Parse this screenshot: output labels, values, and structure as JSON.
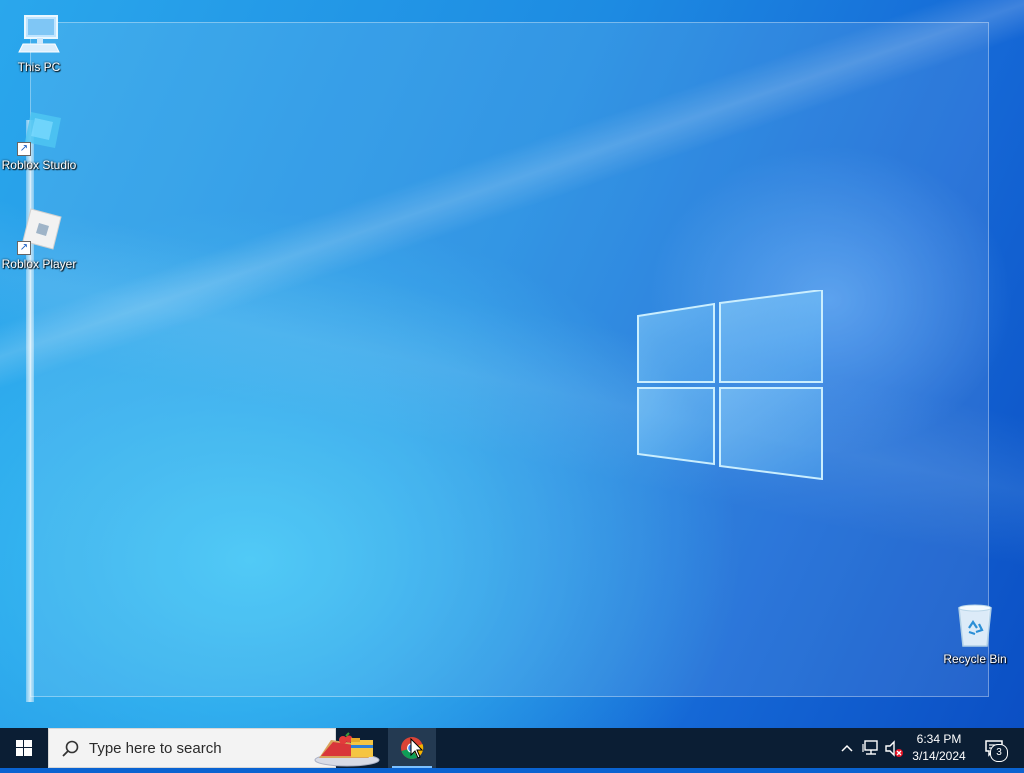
{
  "desktop": {
    "icons": [
      {
        "label": "This PC",
        "icon": "this-pc-icon"
      },
      {
        "label": "Roblox Studio",
        "icon": "roblox-studio-icon"
      },
      {
        "label": "Roblox Player",
        "icon": "roblox-player-icon"
      },
      {
        "label": "Recycle Bin",
        "icon": "recycle-bin-icon"
      }
    ]
  },
  "taskbar": {
    "search_placeholder": "Type here to search",
    "pinned": [
      {
        "name": "File Explorer",
        "icon": "file-explorer-icon"
      },
      {
        "name": "Google Chrome",
        "icon": "chrome-icon",
        "active": true
      }
    ],
    "clock": {
      "time": "6:34 PM",
      "date": "3/14/2024"
    },
    "notifications_count": "3"
  },
  "colors": {
    "taskbar": "#0b1e34",
    "accent": "#7cc0ff",
    "wallpaper_primary": "#1d8be2"
  }
}
